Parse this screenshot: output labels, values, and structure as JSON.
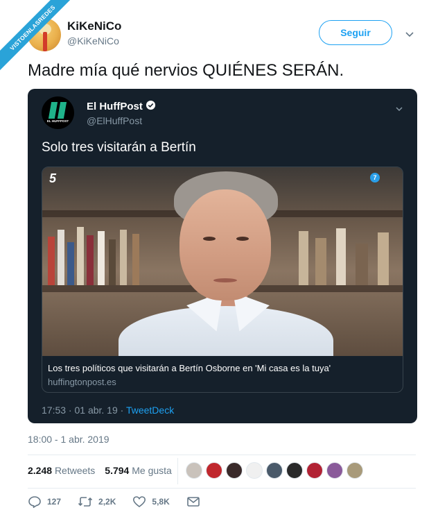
{
  "watermark": "VISTOENLASREDES",
  "author": {
    "name": "KiKeNiCo",
    "handle": "@KiKeNiCo"
  },
  "follow_label": "Seguir",
  "tweet_text": "Madre mía qué nervios QUIÉNES SERÁN.",
  "quoted": {
    "logo_text": "EL HUFFPOST",
    "name": "El HuffPost",
    "handle": "@ElHuffPost",
    "text": "Solo tres visitarán a Bertín",
    "channel_badge": "5",
    "channel_icon": "7",
    "card_title": "Los tres políticos que visitarán a Bertín Osborne en 'Mi casa es la tuya'",
    "card_domain": "huffingtonpost.es",
    "time": "17:53 · 01 abr. 19 · ",
    "source": "TweetDeck"
  },
  "timestamp": "18:00 - 1 abr. 2019",
  "stats": {
    "retweets_count": "2.248",
    "retweets_label": "Retweets",
    "likes_count": "5.794",
    "likes_label": "Me gusta"
  },
  "liker_colors": [
    "#c9c2bb",
    "#c0272d",
    "#3a2a2a",
    "#f0f0f0",
    "#4a5a6a",
    "#2a2a2a",
    "#b22234",
    "#8a5a9a",
    "#a89a7a"
  ],
  "actions": {
    "reply_count": "127",
    "retweet_count": "2,2K",
    "like_count": "5,8K"
  },
  "colors": {
    "accent": "#1da1f2",
    "dark_bg": "#15202b"
  }
}
